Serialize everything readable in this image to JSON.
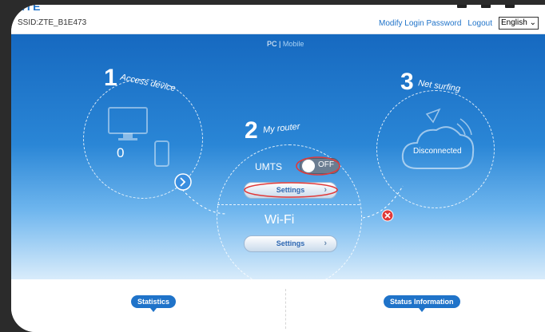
{
  "header": {
    "logo": "ZTE",
    "ssid": "SSID:ZTE_B1E473",
    "modify_password": "Modify Login Password",
    "logout": "Logout",
    "language": "English"
  },
  "view_switch": {
    "pc": "PC",
    "separator": "|",
    "mobile": "Mobile"
  },
  "access_device": {
    "step": "1",
    "title": "Access device",
    "count": "0"
  },
  "my_router": {
    "step": "2",
    "title": "My router",
    "umts_label": "UMTS",
    "umts_toggle": "OFF",
    "umts_settings": "Settings",
    "wifi_label": "Wi-Fi",
    "wifi_settings": "Settings"
  },
  "net_surfing": {
    "step": "3",
    "title": "Net surfing",
    "status": "Disconnected"
  },
  "bottom": {
    "statistics": "Statistics",
    "status_information": "Status Information"
  },
  "colors": {
    "accent": "#1f73c9",
    "error": "#e03a3a",
    "toggle_off": "#6b7d91"
  }
}
